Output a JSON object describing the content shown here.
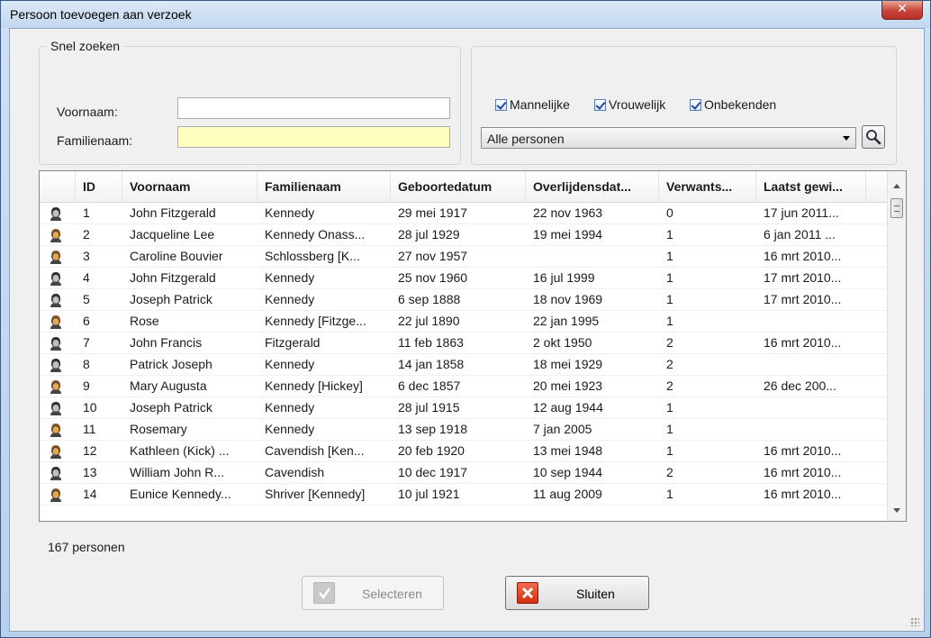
{
  "window": {
    "title": "Persoon toevoegen aan verzoek"
  },
  "quick_search": {
    "legend": "Snel zoeken",
    "firstname_label": "Voornaam:",
    "firstname_value": "",
    "lastname_label": "Familienaam:",
    "lastname_value": ""
  },
  "filters": {
    "checkboxes": [
      {
        "label": "Mannelijke",
        "checked": true
      },
      {
        "label": "Vrouwelijk",
        "checked": true
      },
      {
        "label": "Onbekenden",
        "checked": true
      }
    ],
    "scope_selected": "Alle personen"
  },
  "table": {
    "columns": [
      "ID",
      "Voornaam",
      "Familienaam",
      "Geboortedatum",
      "Overlijdensdat...",
      "Verwants...",
      "Laatst gewi..."
    ],
    "rows": [
      {
        "icon": "male",
        "cells": [
          "1",
          "John Fitzgerald",
          "Kennedy",
          "29 mei 1917",
          "22 nov 1963",
          "0",
          "17 jun 2011..."
        ]
      },
      {
        "icon": "female",
        "cells": [
          "2",
          "Jacqueline Lee",
          "Kennedy Onass...",
          "28 jul 1929",
          "19 mei 1994",
          "1",
          "6 jan 2011 ..."
        ]
      },
      {
        "icon": "female",
        "cells": [
          "3",
          "Caroline Bouvier",
          "Schlossberg [K...",
          "27 nov 1957",
          "",
          "1",
          "16 mrt 2010..."
        ]
      },
      {
        "icon": "male",
        "cells": [
          "4",
          "John Fitzgerald",
          "Kennedy",
          "25 nov 1960",
          "16 jul 1999",
          "1",
          "17 mrt 2010..."
        ]
      },
      {
        "icon": "male",
        "cells": [
          "5",
          "Joseph Patrick",
          "Kennedy",
          "6 sep 1888",
          "18 nov 1969",
          "1",
          "17 mrt 2010..."
        ]
      },
      {
        "icon": "female",
        "cells": [
          "6",
          "Rose",
          "Kennedy [Fitzge...",
          "22 jul 1890",
          "22 jan 1995",
          "1",
          ""
        ]
      },
      {
        "icon": "male",
        "cells": [
          "7",
          "John Francis",
          "Fitzgerald",
          "11 feb 1863",
          "2 okt 1950",
          "2",
          "16 mrt 2010..."
        ]
      },
      {
        "icon": "male",
        "cells": [
          "8",
          "Patrick Joseph",
          "Kennedy",
          "14 jan 1858",
          "18 mei 1929",
          "2",
          ""
        ]
      },
      {
        "icon": "female",
        "cells": [
          "9",
          "Mary Augusta",
          "Kennedy [Hickey]",
          "6 dec 1857",
          "20 mei 1923",
          "2",
          "26 dec 200..."
        ]
      },
      {
        "icon": "male",
        "cells": [
          "10",
          "Joseph Patrick",
          "Kennedy",
          "28 jul 1915",
          "12 aug 1944",
          "1",
          ""
        ]
      },
      {
        "icon": "female",
        "cells": [
          "11",
          "Rosemary",
          "Kennedy",
          "13 sep 1918",
          "7 jan 2005",
          "1",
          ""
        ]
      },
      {
        "icon": "female",
        "cells": [
          "12",
          "Kathleen (Kick) ...",
          "Cavendish [Ken...",
          "20 feb 1920",
          "13 mei 1948",
          "1",
          "16 mrt 2010..."
        ]
      },
      {
        "icon": "male",
        "cells": [
          "13",
          "William John R...",
          "Cavendish",
          "10 dec 1917",
          "10 sep 1944",
          "2",
          "16 mrt 2010..."
        ]
      },
      {
        "icon": "female",
        "cells": [
          "14",
          "Eunice Kennedy...",
          "Shriver [Kennedy]",
          "10 jul 1921",
          "11 aug 2009",
          "1",
          "16 mrt 2010..."
        ]
      }
    ]
  },
  "status": {
    "count_text": "167 personen"
  },
  "buttons": {
    "select_label": "Selecteren",
    "close_label": "Sluiten"
  },
  "colors": {
    "accent": "#ffffc0",
    "title_bar": "#c3d7ef",
    "close": "#c8443a"
  }
}
